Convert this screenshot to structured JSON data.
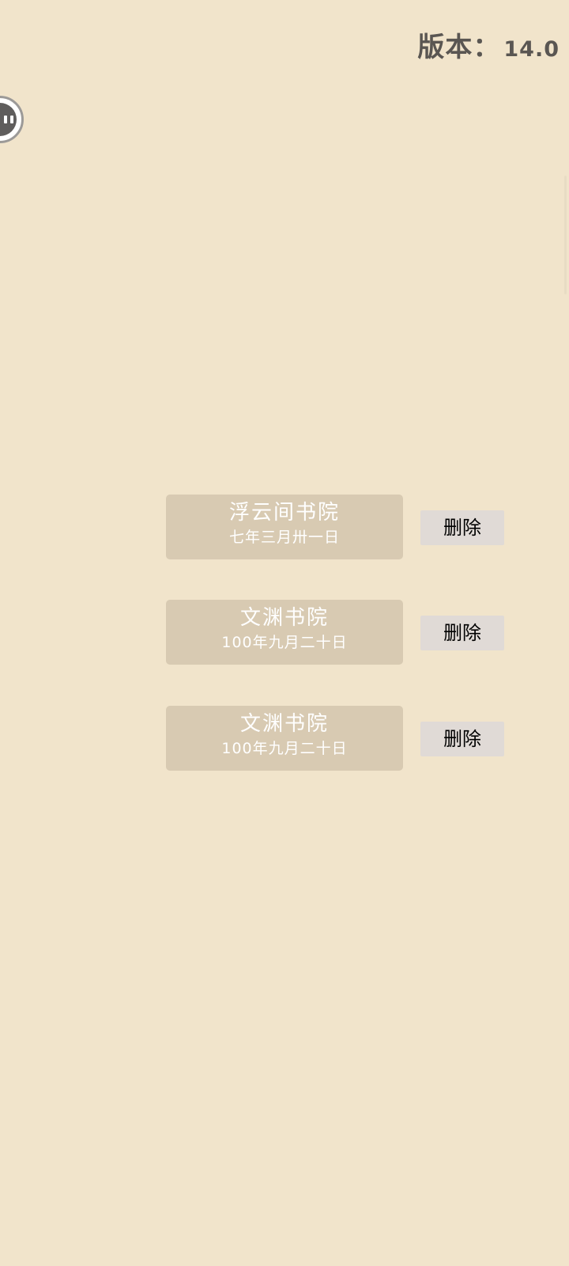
{
  "header": {
    "version_label": "版本：",
    "version_value": "14.0"
  },
  "floating_assistant": {
    "icon": "assistant-ball-icon"
  },
  "saves": [
    {
      "name": "浮云间书院",
      "date": "七年三月卅一日",
      "delete_label": "删除"
    },
    {
      "name": "文渊书院",
      "date": "100年九月二十日",
      "delete_label": "删除"
    },
    {
      "name": "文渊书院",
      "date": "100年九月二十日",
      "delete_label": "删除"
    }
  ],
  "colors": {
    "background": "#f1e4cb",
    "card": "#d8cab2",
    "delete_button": "#e0dad6",
    "version_text": "#5a5652"
  }
}
